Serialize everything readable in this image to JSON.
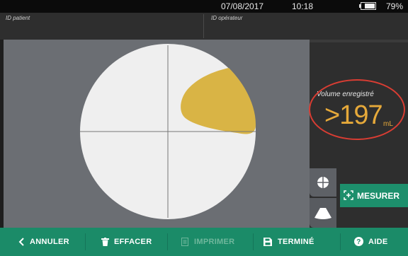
{
  "status": {
    "date": "07/08/2017",
    "time": "10:18",
    "battery_percent": "79%",
    "battery_level": 0.79
  },
  "patient": {
    "id_patient_label": "ID patient",
    "id_operator_label": "ID opérateur"
  },
  "volume": {
    "label": "Volume enregistré",
    "value": ">197",
    "unit": "mL"
  },
  "colors": {
    "accent_green": "#1b8b68",
    "bladder_fill": "#d9b445",
    "value_orange": "#e6a93a",
    "highlight_red": "#d93d33"
  },
  "side_buttons": {
    "crosshair_icon": "crosshair-icon",
    "cone_icon": "ultrasound-cone-icon"
  },
  "measure_button": {
    "label": "MESURER",
    "icon": "scan-target-icon"
  },
  "bottom_bar": {
    "cancel": "ANNULER",
    "erase": "EFFACER",
    "print": "IMPRIMER",
    "done": "TERMINÉ",
    "help": "AIDE"
  }
}
